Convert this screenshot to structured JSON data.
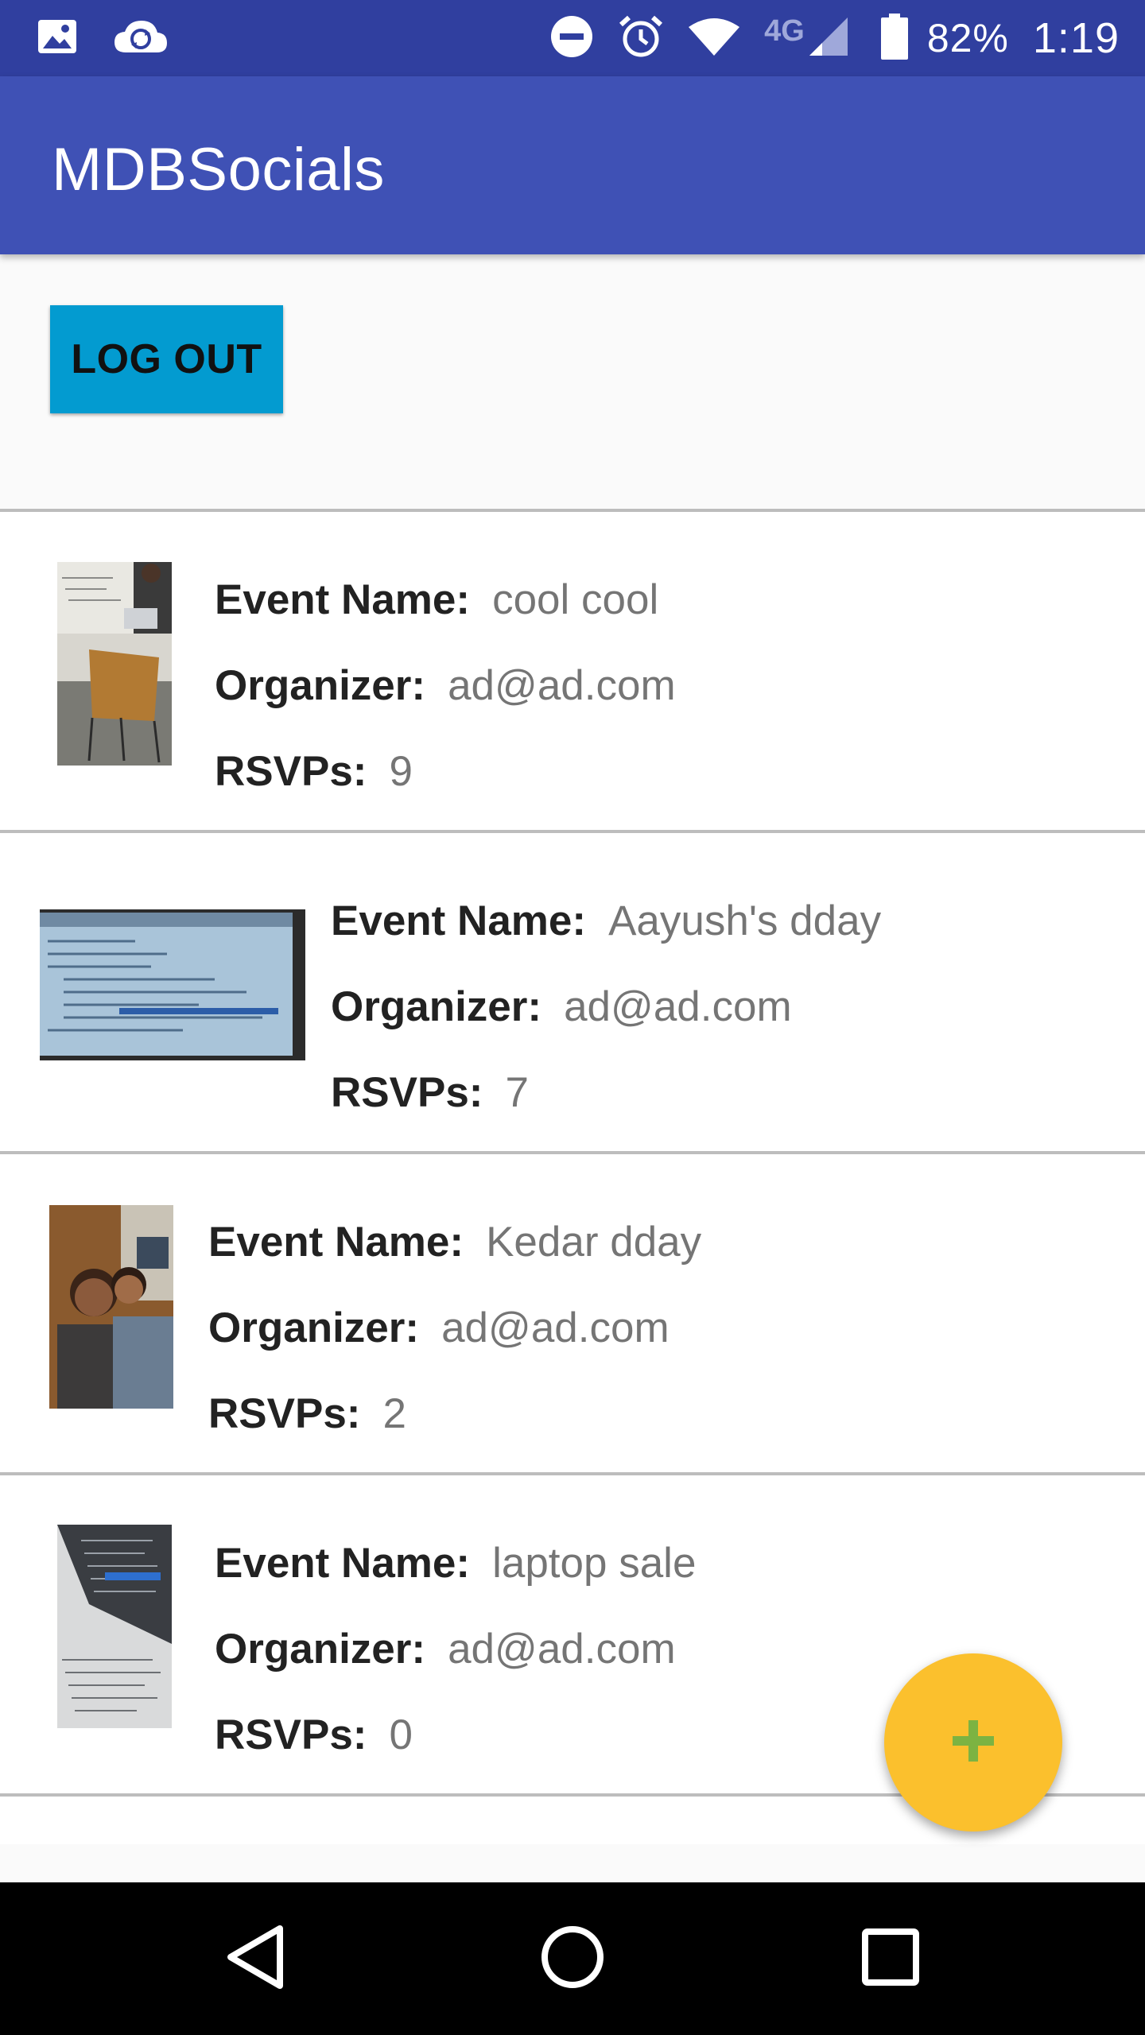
{
  "status_bar": {
    "icons": [
      "image-icon",
      "cloud-sync-icon",
      "do-not-disturb-icon",
      "alarm-icon",
      "wifi-icon",
      "network-4g-lte-icon",
      "cell-signal-icon",
      "battery-icon"
    ],
    "network_label": "4G",
    "battery_percent": "82%",
    "time": "1:19"
  },
  "app_bar": {
    "title": "MDBSocials"
  },
  "logout_button": {
    "label": "LOG OUT"
  },
  "labels": {
    "event_name": "Event Name:",
    "organizer": "Organizer:",
    "rsvps": "RSVPs:"
  },
  "events": [
    {
      "name": "cool cool",
      "organizer": "ad@ad.com",
      "rsvps": "9"
    },
    {
      "name": "Aayush's dday",
      "organizer": "ad@ad.com",
      "rsvps": "7"
    },
    {
      "name": "Kedar dday",
      "organizer": "ad@ad.com",
      "rsvps": "2"
    },
    {
      "name": "laptop sale",
      "organizer": "ad@ad.com",
      "rsvps": "0"
    }
  ],
  "fab": {
    "icon": "plus-icon"
  },
  "nav_bar": {
    "icons": [
      "back-icon",
      "home-icon",
      "recents-icon"
    ]
  },
  "colors": {
    "status_bar": "#303f9f",
    "app_bar": "#3f51b5",
    "logout_button": "#039bd0",
    "fab": "#fbc02d",
    "fab_plus": "#7cb342"
  }
}
